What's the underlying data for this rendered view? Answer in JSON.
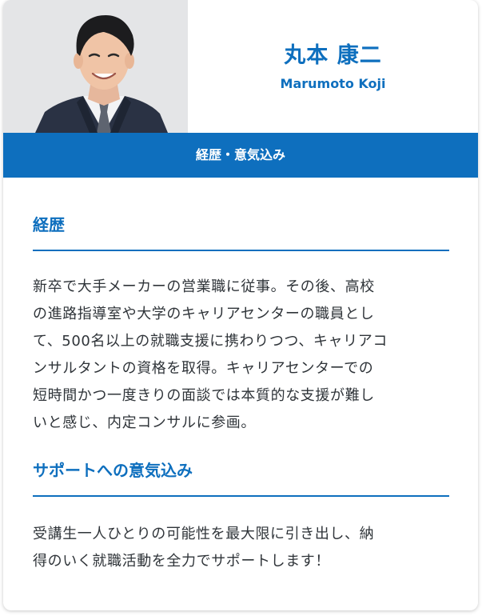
{
  "profile": {
    "name_ja": "丸本 康二",
    "name_en": "Marumoto Koji",
    "photo_alt": "Marumoto Koji"
  },
  "banner": {
    "label": "経歴・意気込み"
  },
  "sections": [
    {
      "heading": "経歴",
      "lines": [
        "新卒で大手メーカーの営業職に従事。その後、高校",
        "の進路指導室や大学のキャリアセンターの職員とし",
        "て、500名以上の就職支援に携わりつつ、キャリアコ",
        "ンサルタントの資格を取得。キャリアセンターでの",
        "短時間かつ一度きりの面談では本質的な支援が難し",
        "いと感じ、内定コンサルに参画。"
      ]
    },
    {
      "heading": "サポートへの意気込み",
      "lines": [
        "受講生一人ひとりの可能性を最大限に引き出し、納",
        "得のいく就職活動を全力でサポートします！"
      ]
    }
  ],
  "colors": {
    "accent": "#0e6fbe",
    "body_text": "#2f3439",
    "photo_background": "#e4e5e7"
  }
}
